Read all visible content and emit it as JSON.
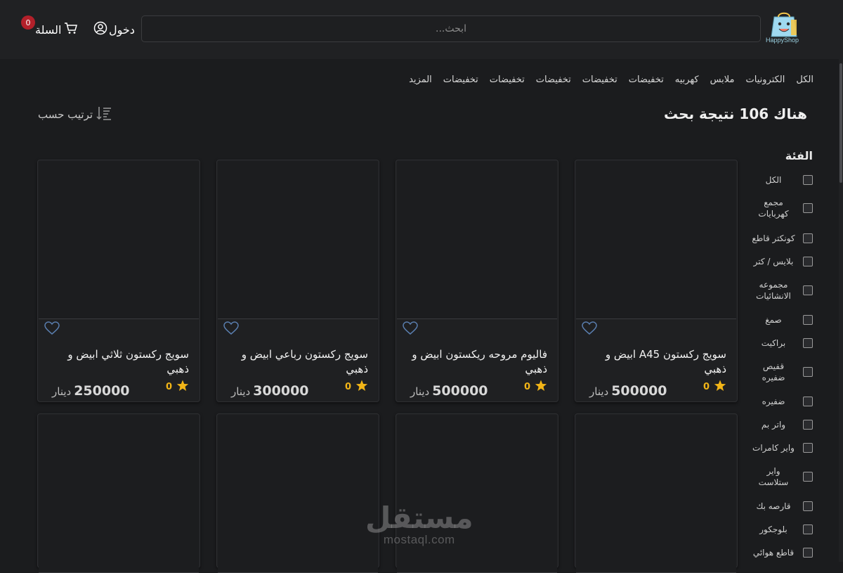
{
  "brand": {
    "name": "HappyShop",
    "icon": "shopping-bag-logo"
  },
  "header": {
    "search_placeholder": "ابحث...",
    "login_label": "دخول",
    "cart_label": "السلة",
    "cart_count": "0"
  },
  "categories": [
    "الكل",
    "الكترونيات",
    "ملابس",
    "كهربيه",
    "تخفيضات",
    "تخفيضات",
    "تخفيضات",
    "تخفيضات",
    "تخفيضات",
    "المزيد"
  ],
  "results": {
    "title": "هناك 106 نتيجة بحث",
    "sort_label": "ترتيب حسب"
  },
  "filter": {
    "title": "الفئة",
    "items": [
      "الكل",
      "مجمع كهربايات",
      "كونكتر قاطع",
      "بلايس / كتر",
      "مجموعه الانشائيات",
      "صمغ",
      "براكيت",
      "قفيص ضفيره",
      "ضفيره",
      "واتر بم",
      "واير كامرات",
      "واير ستلاست",
      "قارصه بك",
      "بلوجكور",
      "قاطع هوائي"
    ]
  },
  "products": [
    {
      "title": "سويج ركستون A45 ابيض و ذهبي",
      "price": "500000",
      "currency": "دينار",
      "rating": "0"
    },
    {
      "title": "فاليوم مروحه ريكستون ابيض و ذهبي",
      "price": "500000",
      "currency": "دينار",
      "rating": "0"
    },
    {
      "title": "سويج ركستون رباعي ابيض و ذهبي",
      "price": "300000",
      "currency": "دينار",
      "rating": "0"
    },
    {
      "title": "سويج ركستون ثلاثي ابيض و ذهبي",
      "price": "250000",
      "currency": "دينار",
      "rating": "0"
    }
  ],
  "watermark": {
    "ar": "مستقل",
    "en": "mostaql.com"
  },
  "colors": {
    "background": "#1b1c1e",
    "header": "#202123",
    "accent_star": "#f2b517",
    "badge": "#b3202a"
  }
}
